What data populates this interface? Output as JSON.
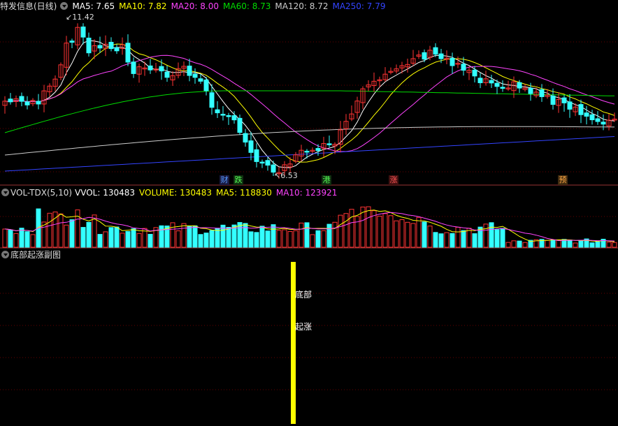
{
  "main_panel": {
    "title": "特发信息(日线)",
    "indicators": [
      {
        "label": "MA5: 7.65",
        "color": "#ffffff"
      },
      {
        "label": "MA10: 7.82",
        "color": "#ffff00"
      },
      {
        "label": "MA20: 8.00",
        "color": "#ff44ff"
      },
      {
        "label": "MA60: 8.73",
        "color": "#00dd00"
      },
      {
        "label": "MA120: 8.72",
        "color": "#cccccc"
      },
      {
        "label": "MA250: 7.79",
        "color": "#3344ff"
      }
    ],
    "high_note": "11.42",
    "low_note": "6.53",
    "tags": [
      {
        "text": "财",
        "color": "#5599ff",
        "bg": "#1a1a40"
      },
      {
        "text": "跌",
        "color": "#55ff55",
        "bg": "#103010"
      },
      {
        "text": "港",
        "color": "#55ff55",
        "bg": "#103010"
      },
      {
        "text": "涨",
        "color": "#ff5555",
        "bg": "#401010"
      },
      {
        "text": "预",
        "color": "#ffaa44",
        "bg": "#402a10"
      }
    ]
  },
  "volume_panel": {
    "title": "VOL-TDX(5,10)",
    "indicators": [
      {
        "label": "VVOL: 130483",
        "color": "#ffffff"
      },
      {
        "label": "VOLUME: 130483",
        "color": "#ffff00"
      },
      {
        "label": "MA5: 118830",
        "color": "#ffff00"
      },
      {
        "label": "MA10: 123921",
        "color": "#ff44ff"
      }
    ]
  },
  "sub_panel": {
    "title": "底部起涨副图",
    "label_bottom": "底部",
    "label_rise": "起涨"
  },
  "colors": {
    "up": "#ff3333",
    "down": "#33ffff",
    "grid": "#660000",
    "divider": "#993333",
    "signal_bar": "#ffff00"
  }
}
